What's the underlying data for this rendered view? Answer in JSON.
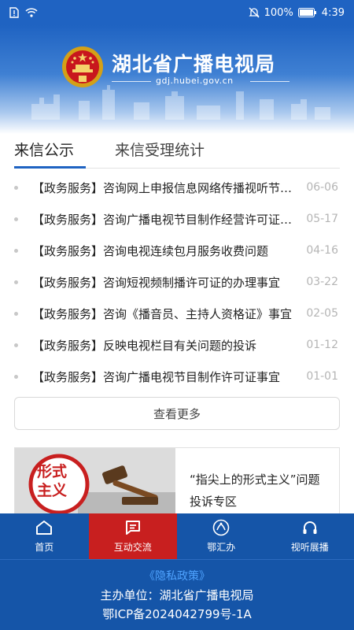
{
  "status_bar": {
    "battery": "100%",
    "time": "4:39"
  },
  "header": {
    "title": "湖北省广播电视局",
    "url": "gdj.hubei.gov.cn"
  },
  "tabs": [
    {
      "label": "来信公示",
      "active": true
    },
    {
      "label": "来信受理统计",
      "active": false
    }
  ],
  "news": [
    {
      "title": "【政务服务】咨询网上申报信息网络传播视听节目许可证事宜",
      "date": "06-06"
    },
    {
      "title": "【政务服务】咨询广播电视节目制作经营许可证办理事宜",
      "date": "05-17"
    },
    {
      "title": "【政务服务】咨询电视连续包月服务收费问题",
      "date": "04-16"
    },
    {
      "title": "【政务服务】咨询短视频制播许可证的办理事宜",
      "date": "03-22"
    },
    {
      "title": "【政务服务】咨询《播音员、主持人资格证》事宜",
      "date": "02-05"
    },
    {
      "title": "【政务服务】反映电视栏目有关问题的投诉",
      "date": "01-12"
    },
    {
      "title": "【政务服务】咨询广播电视节目制作许可证事宜",
      "date": "01-01"
    }
  ],
  "more_label": "查看更多",
  "promo": {
    "image_text_1": "形式",
    "image_text_2": "主义",
    "text": "“指尖上的形式主义”问题投诉专区"
  },
  "bottom_nav": [
    {
      "label": "首页",
      "icon": "home-icon",
      "active": false
    },
    {
      "label": "互动交流",
      "icon": "message-icon",
      "active": true
    },
    {
      "label": "鄂汇办",
      "icon": "ehuiban-logo-icon",
      "active": false
    },
    {
      "label": "视听展播",
      "icon": "headphones-icon",
      "active": false
    }
  ],
  "footer": {
    "privacy": "《隐私政策》",
    "host": "主办单位：湖北省广播电视局",
    "icp": "鄂ICP备2024042799号-1A"
  },
  "colors": {
    "primary_blue": "#1f63c2",
    "nav_blue": "#1555a8",
    "active_red": "#c81f1f",
    "link_blue": "#4fa3ff"
  }
}
